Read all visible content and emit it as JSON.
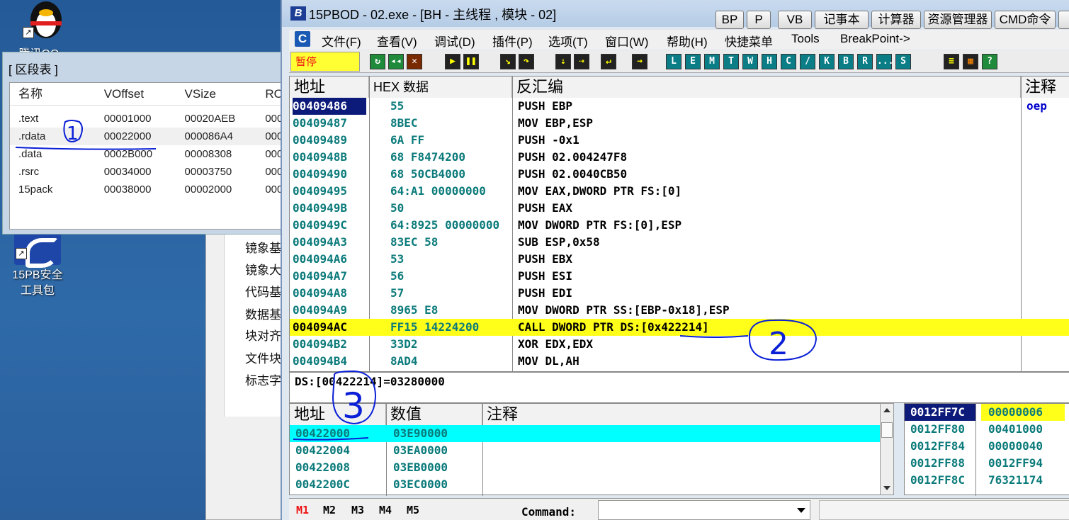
{
  "desktop": {
    "icons": [
      {
        "label": "腾讯QQ"
      },
      {
        "label": "15PB安全工具包"
      }
    ]
  },
  "section_window": {
    "title": "[ 区段表 ]",
    "columns": [
      "名称",
      "VOffset",
      "VSize",
      "RO"
    ],
    "rows": [
      {
        "name": ".text",
        "voffset": "00001000",
        "vsize": "00020AEB",
        "ro": "000"
      },
      {
        "name": ".rdata",
        "voffset": "00022000",
        "vsize": "000086A4",
        "ro": "000"
      },
      {
        "name": ".data",
        "voffset": "0002B000",
        "vsize": "00008308",
        "ro": "000"
      },
      {
        "name": ".rsrc",
        "voffset": "00034000",
        "vsize": "00003750",
        "ro": "000"
      },
      {
        "name": "15pack",
        "voffset": "00038000",
        "vsize": "00002000",
        "ro": "000"
      }
    ]
  },
  "bg_panel": {
    "labels": [
      "镜象基",
      "镜象大",
      "代码基",
      "数据基",
      "块对齐",
      "文件块",
      "标志字"
    ]
  },
  "od": {
    "title": "15PBOD  - 02.exe - [BH - 主线程 , 模块 - 02]",
    "title_buttons": [
      "BP",
      "P",
      "VB",
      "记事本",
      "计算器",
      "资源管理器",
      "CMD命令"
    ],
    "menu": [
      "文件(F)",
      "查看(V)",
      "调试(D)",
      "插件(P)",
      "选项(T)",
      "窗口(W)",
      "帮助(H)",
      "快捷菜单",
      "Tools",
      "BreakPoint->"
    ],
    "pause_label": "暂停",
    "toolbar_letters": [
      "L",
      "E",
      "M",
      "T",
      "W",
      "H",
      "C",
      "/",
      "K",
      "B",
      "R",
      "...",
      "S"
    ],
    "disasm": {
      "headers": {
        "address": "地址",
        "hex": "HEX 数据",
        "disasm": "反汇编",
        "comment": "注释"
      },
      "rows": [
        {
          "addr": "00409486",
          "hex": "55",
          "asm": "PUSH EBP",
          "comment": "oep"
        },
        {
          "addr": "00409487",
          "hex": "8BEC",
          "asm": "MOV EBP,ESP",
          "comment": ""
        },
        {
          "addr": "00409489",
          "hex": "6A FF",
          "asm": "PUSH -0x1",
          "comment": ""
        },
        {
          "addr": "0040948B",
          "hex": "68 F8474200",
          "asm": "PUSH 02.004247F8",
          "comment": ""
        },
        {
          "addr": "00409490",
          "hex": "68 50CB4000",
          "asm": "PUSH 02.0040CB50",
          "comment": ""
        },
        {
          "addr": "00409495",
          "hex": "64:A1 00000000",
          "asm": "MOV EAX,DWORD PTR FS:[0]",
          "comment": ""
        },
        {
          "addr": "0040949B",
          "hex": "50",
          "asm": "PUSH EAX",
          "comment": ""
        },
        {
          "addr": "0040949C",
          "hex": "64:8925 00000000",
          "asm": "MOV DWORD PTR FS:[0],ESP",
          "comment": ""
        },
        {
          "addr": "004094A3",
          "hex": "83EC 58",
          "asm": "SUB ESP,0x58",
          "comment": ""
        },
        {
          "addr": "004094A6",
          "hex": "53",
          "asm": "PUSH EBX",
          "comment": ""
        },
        {
          "addr": "004094A7",
          "hex": "56",
          "asm": "PUSH ESI",
          "comment": ""
        },
        {
          "addr": "004094A8",
          "hex": "57",
          "asm": "PUSH EDI",
          "comment": ""
        },
        {
          "addr": "004094A9",
          "hex": "8965 E8",
          "asm": "MOV DWORD PTR SS:[EBP-0x18],ESP",
          "comment": ""
        },
        {
          "addr": "004094AC",
          "hex": "FF15 14224200",
          "asm": "CALL DWORD PTR DS:[0x422214]",
          "comment": ""
        },
        {
          "addr": "004094B2",
          "hex": "33D2",
          "asm": "XOR EDX,EDX",
          "comment": ""
        },
        {
          "addr": "004094B4",
          "hex": "8AD4",
          "asm": "MOV DL,AH",
          "comment": ""
        }
      ]
    },
    "info_line": "DS:[00422214]=03280000",
    "dump": {
      "headers": {
        "address": "地址",
        "value": "数值",
        "comment": "注释"
      },
      "rows": [
        {
          "addr": "00422000",
          "value": "03E90000"
        },
        {
          "addr": "00422004",
          "value": "03EA0000"
        },
        {
          "addr": "00422008",
          "value": "03EB0000"
        },
        {
          "addr": "0042200C",
          "value": "03EC0000"
        }
      ]
    },
    "stack": {
      "rows": [
        {
          "addr": "0012FF7C",
          "value": "00000006"
        },
        {
          "addr": "0012FF80",
          "value": "00401000"
        },
        {
          "addr": "0012FF84",
          "value": "00000040"
        },
        {
          "addr": "0012FF88",
          "value": "0012FF94"
        },
        {
          "addr": "0012FF8C",
          "value": "76321174"
        }
      ]
    },
    "status": {
      "tabs": [
        "M1",
        "M2",
        "M3",
        "M4",
        "M5"
      ],
      "command_label": "Command:"
    }
  },
  "annotations": [
    "1",
    "2",
    "3"
  ]
}
